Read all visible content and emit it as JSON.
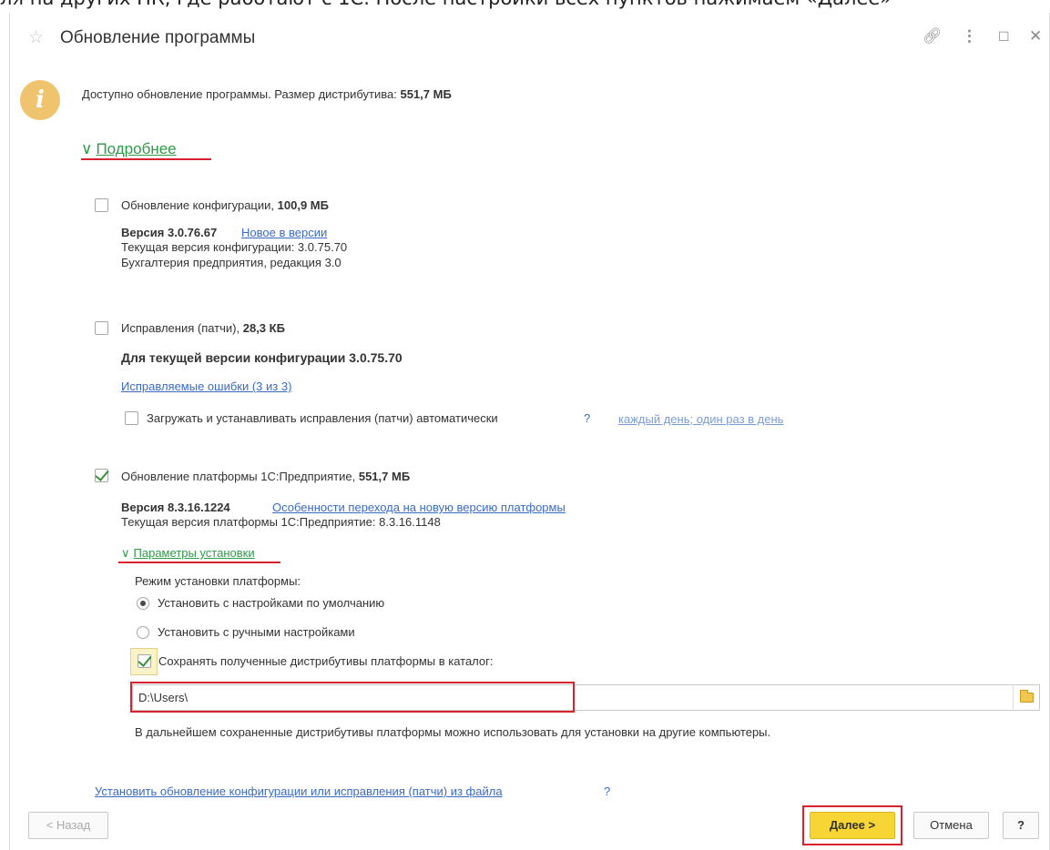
{
  "banner": {
    "text": "ля на других ПК, где работают с 1С. После настройки всех пунктов нажимаем «Далее»"
  },
  "window": {
    "title": "Обновление программы"
  },
  "info": {
    "text": "Доступно обновление программы. Размер дистрибутива:",
    "size": "551,7 МБ"
  },
  "details_link": "Подробнее",
  "config": {
    "label": "Обновление конфигурации,",
    "size": "100,9 МБ",
    "version": "Версия 3.0.76.67",
    "whats_new": "Новое в версии",
    "current": "Текущая версия конфигурации: 3.0.75.70",
    "product": "Бухгалтерия предприятия, редакция 3.0"
  },
  "patches": {
    "label": "Исправления (патчи),",
    "size": "28,3 КБ",
    "for_version": "Для текущей версии конфигурации 3.0.75.70",
    "fixed_link": "Исправляемые ошибки (3 из 3)",
    "auto_label": "Загружать и устанавливать исправления (патчи) автоматически",
    "auto_help": "?",
    "schedule_link": "каждый день; один раз в день"
  },
  "platform": {
    "label": "Обновление платформы 1С:Предприятие,",
    "size": "551,7 МБ",
    "version": "Версия 8.3.16.1224",
    "features_link": "Особенности перехода на новую версию платформы",
    "current": "Текущая версия платформы 1С:Предприятие: 8.3.16.1148",
    "params_link": "Параметры установки",
    "mode_label": "Режим установки платформы:",
    "radio_default": "Установить с настройками по умолчанию",
    "radio_manual": "Установить с ручными настройками",
    "save_label": "Сохранять полученные дистрибутивы платформы в каталог:",
    "path_value": "D:\\Users\\",
    "note": "В дальнейшем сохраненные дистрибутивы платформы можно использовать для установки на другие компьютеры."
  },
  "footer": {
    "install_from_file_link": "Установить обновление конфигурации или исправления (патчи) из файла",
    "help_q": "?",
    "back": "< Назад",
    "next": "Далее >",
    "cancel": "Отмена",
    "help": "?"
  },
  "colors": {
    "accent_red": "#d9222f",
    "link_blue": "#3a6bc4",
    "green": "#2e9b46",
    "primary_yellow": "#f6d535"
  }
}
